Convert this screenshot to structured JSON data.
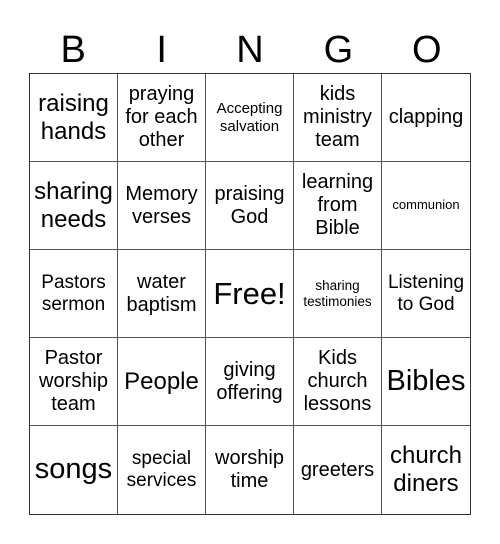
{
  "header": {
    "letters": [
      "B",
      "I",
      "N",
      "G",
      "O"
    ]
  },
  "board": {
    "cells": [
      "raising\nhands",
      "praying\nfor each\nother",
      "Accepting\nsalvation",
      "kids\nministry\nteam",
      "clapping",
      "sharing\nneeds",
      "Memory\nverses",
      "praising\nGod",
      "learning\nfrom\nBible",
      "communion",
      "Pastors\nsermon",
      "water\nbaptism",
      "Free!",
      "sharing\ntestimonies",
      "Listening\nto God",
      "Pastor\nworship\nteam",
      "People",
      "giving\noffering",
      "Kids\nchurch\nlessons",
      "Bibles",
      "songs",
      "special\nservices",
      "worship\ntime",
      "greeters",
      "church\ndiners"
    ]
  }
}
